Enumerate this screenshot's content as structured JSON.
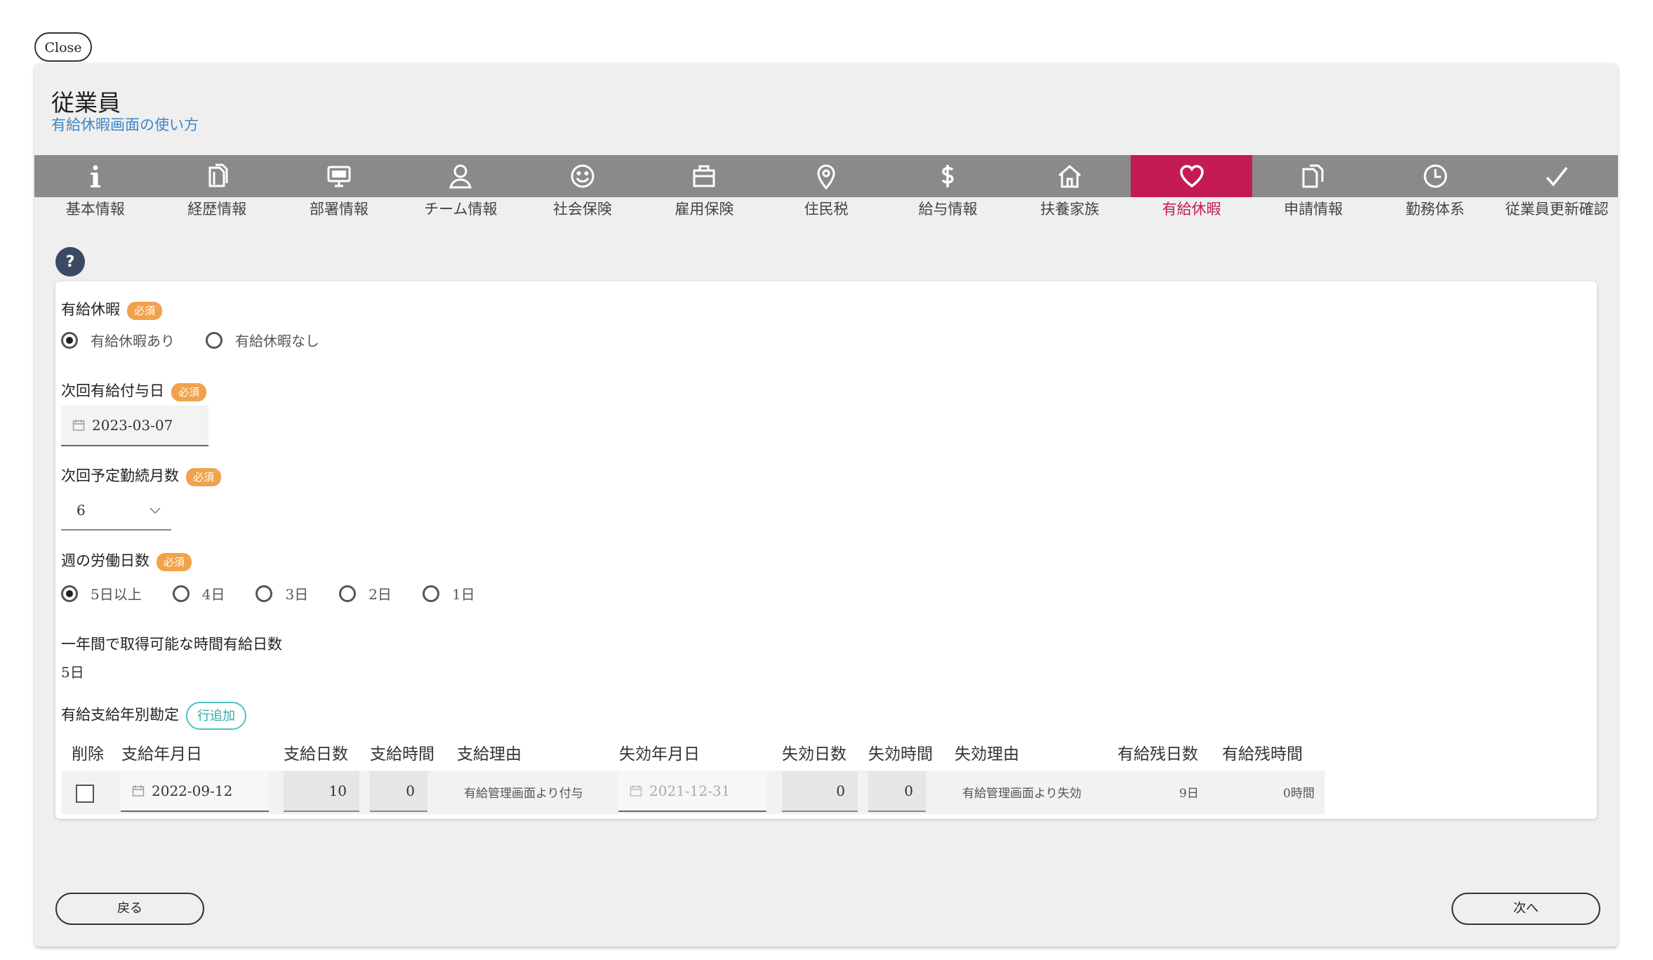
{
  "close_label": "Close",
  "header": {
    "title": "従業員",
    "help_link": "有給休暇画面の使い方"
  },
  "tabs": [
    {
      "label": "基本情報",
      "icon": "info-icon",
      "active": false
    },
    {
      "label": "経歴情報",
      "icon": "document-icon",
      "active": false
    },
    {
      "label": "部署情報",
      "icon": "monitor-icon",
      "active": false
    },
    {
      "label": "チーム情報",
      "icon": "user-icon",
      "active": false
    },
    {
      "label": "社会保険",
      "icon": "smile-icon",
      "active": false
    },
    {
      "label": "雇用保険",
      "icon": "briefcase-icon",
      "active": false
    },
    {
      "label": "住民税",
      "icon": "location-pin-icon",
      "active": false
    },
    {
      "label": "給与情報",
      "icon": "dollar-icon",
      "active": false
    },
    {
      "label": "扶養家族",
      "icon": "home-icon",
      "active": false
    },
    {
      "label": "有給休暇",
      "icon": "heart-icon",
      "active": true
    },
    {
      "label": "申請情報",
      "icon": "copy-document-icon",
      "active": false
    },
    {
      "label": "勤務体系",
      "icon": "clock-icon",
      "active": false
    },
    {
      "label": "従業員更新確認",
      "icon": "check-icon",
      "active": false
    }
  ],
  "help_icon": "?",
  "required_badge": "必須",
  "form": {
    "paid_leave": {
      "label": "有給休暇",
      "options": [
        "有給休暇あり",
        "有給休暇なし"
      ],
      "selected": 0
    },
    "next_grant_date": {
      "label": "次回有給付与日",
      "value": "2023-03-07"
    },
    "next_months": {
      "label": "次回予定勤続月数",
      "value": "6"
    },
    "weekly_days": {
      "label": "週の労働日数",
      "options": [
        "5日以上",
        "4日",
        "3日",
        "2日",
        "1日"
      ],
      "selected": 0
    },
    "hourly_days": {
      "label": "一年間で取得可能な時間有給日数",
      "value": "5日"
    },
    "annual": {
      "label": "有給支給年別勘定",
      "add_row_label": "行追加"
    }
  },
  "table": {
    "headers": [
      "削除",
      "支給年月日",
      "支給日数",
      "支給時間",
      "支給理由",
      "失効年月日",
      "失効日数",
      "失効時間",
      "失効理由",
      "有給残日数",
      "有給残時間"
    ],
    "row": {
      "grant_date": "2022-09-12",
      "grant_days": "10",
      "grant_hours": "0",
      "grant_reason": "有給管理画面より付与",
      "expire_date": "2021-12-31",
      "expire_days": "0",
      "expire_hours": "0",
      "expire_reason": "有給管理画面より失効",
      "remaining_days": "9日",
      "remaining_hours": "0時間"
    }
  },
  "footer": {
    "back_label": "戻る",
    "next_label": "次へ"
  },
  "colors": {
    "active_tab": "#c41b52",
    "tab_bar": "#8a8a8a",
    "link": "#3f86c8",
    "badge": "#f0a34b",
    "accent_teal": "#4cc3c4"
  }
}
